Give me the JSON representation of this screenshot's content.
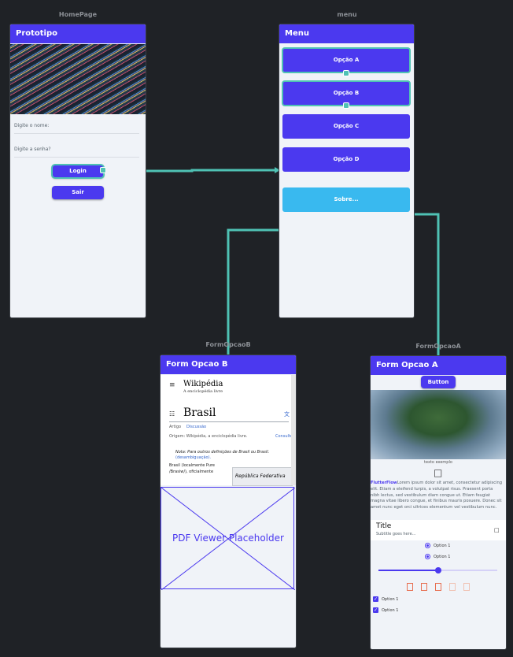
{
  "frames": {
    "home": {
      "label": "HomePage",
      "title": "Prototipo",
      "name_label": "Digite o nome:",
      "password_label": "Digite a senha?",
      "login": "Login",
      "exit": "Sair"
    },
    "menu": {
      "label": "menu",
      "title": "Menu",
      "opt_a": "Opção A",
      "opt_b": "Opção B",
      "opt_c": "Opção C",
      "opt_d": "Opção D",
      "about": "Sobre..."
    },
    "formb": {
      "label": "FormOpcaoB",
      "title": "Form Opcao B",
      "wiki": {
        "brand": "Wikipédia",
        "tagline": "A enciclopédia livre",
        "heading": "Brasil",
        "tab_article": "Artigo",
        "tab_talk": "Discussão",
        "origin": "Origem: Wikipédia, a enciclopédia livre.",
        "more": "Consulte",
        "note": "Nota: Para outros definições de Brasil ou Brasil.",
        "disamb": "(desambiguação).",
        "lead": "Brasil (localmente Pure",
        "lead2": "/Brasiw/), oficialmente",
        "infobox": "República Federativa"
      },
      "pdf": "PDF Viewer Placeholder"
    },
    "forma": {
      "label": "FormOpcaoA",
      "title": "Form Opcao A",
      "button": "Button",
      "caption": "texto exemplo",
      "para_prefix": "FlutterFlow",
      "para": "Lorem ipsum dolor sit amet, consectetur adipiscing elit. Etiam a eleifend turpis, a volutpat risus. Praesent porta nibh lectus, sed vestibulum diam congue ut. Etiam feugiat magna vitae libero congue, et finibus mauris posuere. Donec sit amet nunc eget orci ultrices elementum vel vestibulum nunc.",
      "tile_title": "Title",
      "tile_subtitle": "Subtitle goes here...",
      "radio1": "Option 1",
      "radio2": "Option 1",
      "slider_value": 0.5,
      "rating": 3,
      "rating_max": 5,
      "check1": "Option 1",
      "check2": "Option 1"
    }
  },
  "colors": {
    "primary": "#4b39ef",
    "secondary": "#39b9ef",
    "connector": "#4fc2b4",
    "canvas": "#1f2226"
  }
}
